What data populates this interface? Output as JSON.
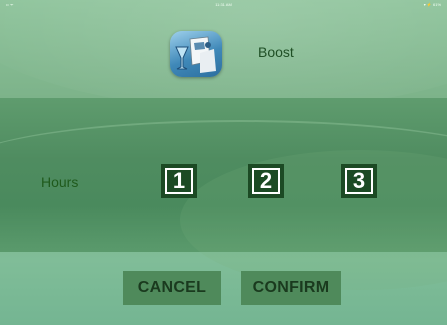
{
  "status_bar": {
    "left": "•• ᯤ",
    "time": "11:31 AM",
    "right": "▾ ⚡ 61%"
  },
  "header": {
    "title": "Boost",
    "icon": "boost-icon"
  },
  "hours": {
    "label": "Hours",
    "options": [
      "1",
      "2",
      "3"
    ]
  },
  "actions": {
    "cancel": "CANCEL",
    "confirm": "CONFIRM"
  }
}
